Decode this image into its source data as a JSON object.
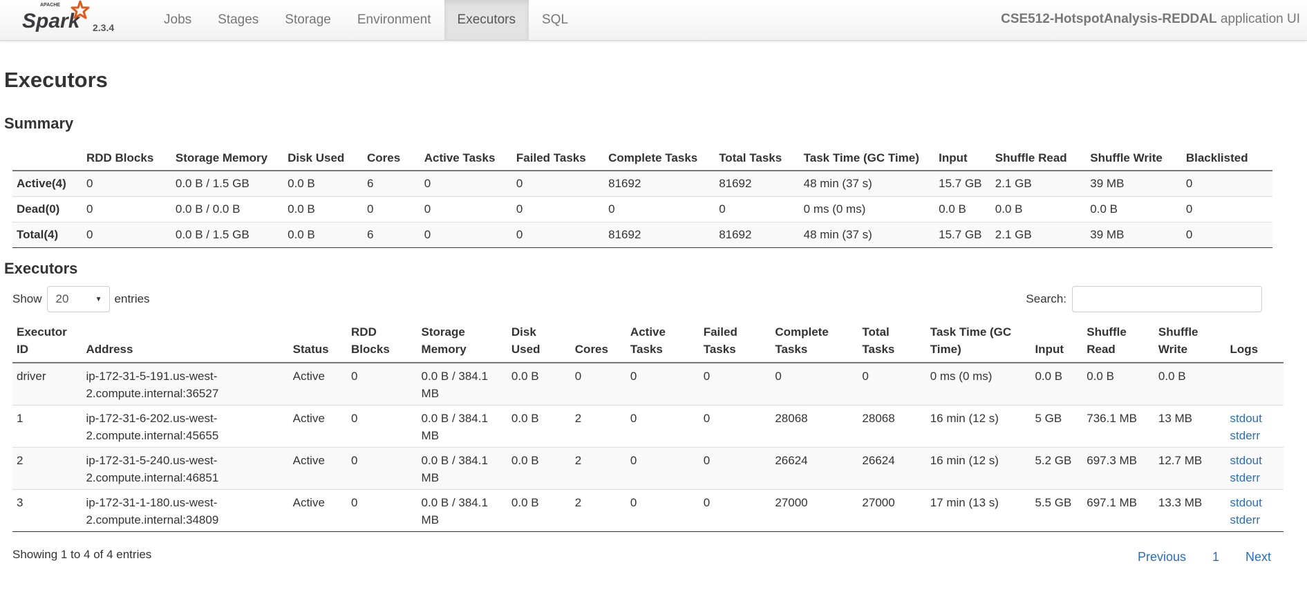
{
  "brand": {
    "logo_text": "Spark",
    "logo_subtext": "APACHE",
    "version": "2.3.4"
  },
  "nav": {
    "tabs": [
      "Jobs",
      "Stages",
      "Storage",
      "Environment",
      "Executors",
      "SQL"
    ],
    "active": "Executors",
    "app_name": "CSE512-HotspotAnalysis-REDDAL",
    "app_suffix": " application UI"
  },
  "page_title": "Executors",
  "summary": {
    "title": "Summary",
    "columns": [
      "",
      "RDD Blocks",
      "Storage Memory",
      "Disk Used",
      "Cores",
      "Active Tasks",
      "Failed Tasks",
      "Complete Tasks",
      "Total Tasks",
      "Task Time (GC Time)",
      "Input",
      "Shuffle Read",
      "Shuffle Write",
      "Blacklisted"
    ],
    "rows": [
      [
        "Active(4)",
        "0",
        "0.0 B / 1.5 GB",
        "0.0 B",
        "6",
        "0",
        "0",
        "81692",
        "81692",
        "48 min (37 s)",
        "15.7 GB",
        "2.1 GB",
        "39 MB",
        "0"
      ],
      [
        "Dead(0)",
        "0",
        "0.0 B / 0.0 B",
        "0.0 B",
        "0",
        "0",
        "0",
        "0",
        "0",
        "0 ms (0 ms)",
        "0.0 B",
        "0.0 B",
        "0.0 B",
        "0"
      ],
      [
        "Total(4)",
        "0",
        "0.0 B / 1.5 GB",
        "0.0 B",
        "6",
        "0",
        "0",
        "81692",
        "81692",
        "48 min (37 s)",
        "15.7 GB",
        "2.1 GB",
        "39 MB",
        "0"
      ]
    ]
  },
  "executors": {
    "title": "Executors",
    "show_label": "Show",
    "page_size": "20",
    "entries_label": "entries",
    "search_label": "Search:",
    "search_value": "",
    "columns": [
      "Executor ID",
      "Address",
      "Status",
      "RDD Blocks",
      "Storage Memory",
      "Disk Used",
      "Cores",
      "Active Tasks",
      "Failed Tasks",
      "Complete Tasks",
      "Total Tasks",
      "Task Time (GC Time)",
      "Input",
      "Shuffle Read",
      "Shuffle Write",
      "Logs"
    ],
    "rows": [
      [
        "driver",
        "ip-172-31-5-191.us-west-2.compute.internal:36527",
        "Active",
        "0",
        "0.0 B / 384.1 MB",
        "0.0 B",
        "0",
        "0",
        "0",
        "0",
        "0",
        "0 ms (0 ms)",
        "0.0 B",
        "0.0 B",
        "0.0 B",
        ""
      ],
      [
        "1",
        "ip-172-31-6-202.us-west-2.compute.internal:45655",
        "Active",
        "0",
        "0.0 B / 384.1 MB",
        "0.0 B",
        "2",
        "0",
        "0",
        "28068",
        "28068",
        "16 min (12 s)",
        "5 GB",
        "736.1 MB",
        "13 MB",
        "stdout|stderr"
      ],
      [
        "2",
        "ip-172-31-5-240.us-west-2.compute.internal:46851",
        "Active",
        "0",
        "0.0 B / 384.1 MB",
        "0.0 B",
        "2",
        "0",
        "0",
        "26624",
        "26624",
        "16 min (12 s)",
        "5.2 GB",
        "697.3 MB",
        "12.7 MB",
        "stdout|stderr"
      ],
      [
        "3",
        "ip-172-31-1-180.us-west-2.compute.internal:34809",
        "Active",
        "0",
        "0.0 B / 384.1 MB",
        "0.0 B",
        "2",
        "0",
        "0",
        "27000",
        "27000",
        "17 min (13 s)",
        "5.5 GB",
        "697.1 MB",
        "13.3 MB",
        "stdout|stderr"
      ]
    ],
    "info": "Showing 1 to 4 of 4 entries",
    "pager": {
      "previous": "Previous",
      "current": "1",
      "next": "Next"
    }
  },
  "colors": {
    "link": "#2a6ebb",
    "logo_orange": "#e25a1c",
    "logo_dark": "#3c3a3e"
  }
}
